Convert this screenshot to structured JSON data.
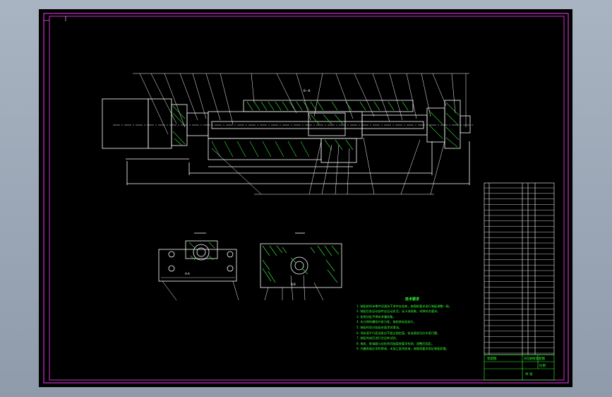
{
  "drawing": {
    "section_label_bottom_left": "A-A",
    "section_label_bottom_right": "B-B",
    "section_label_top": "B—B"
  },
  "tech_notes": {
    "title": "技术要求",
    "lines": [
      "1. 装配前所有零件须清洗干净并去毛刺，按图纸要求进行装配调整一致。",
      "2. 装配后各运动部件应运动灵活，无卡滞现象，间隙符合要求。",
      "3. 各密封处不得有渗漏现象。",
      "4. 未注明的螺栓拧紧力矩，按相关标准执行。",
      "5. 装配时须对各配合面涂润滑油。",
      "6. 导轨面平行度误差应不超过规定值，各连接部位应牢固可靠。",
      "7. 装配完成后进行空运转试验。",
      "8. 电机、联轴器与丝杠的同轴度按要求检测，调整后固定。",
      "9. 外露表面应涂防锈漆，未加工面涂底漆，按图纸要求保证装配质量。"
    ]
  },
  "title_block": {
    "drawing_name": "X向进给装配图",
    "school": "装配图",
    "scale": "比例",
    "sheet": "共 张"
  },
  "colors": {
    "background": "#000000",
    "frame": "#cc33cc",
    "outline": "#ffffff",
    "hatch": "#33cc33",
    "notes": "#33ff33"
  }
}
